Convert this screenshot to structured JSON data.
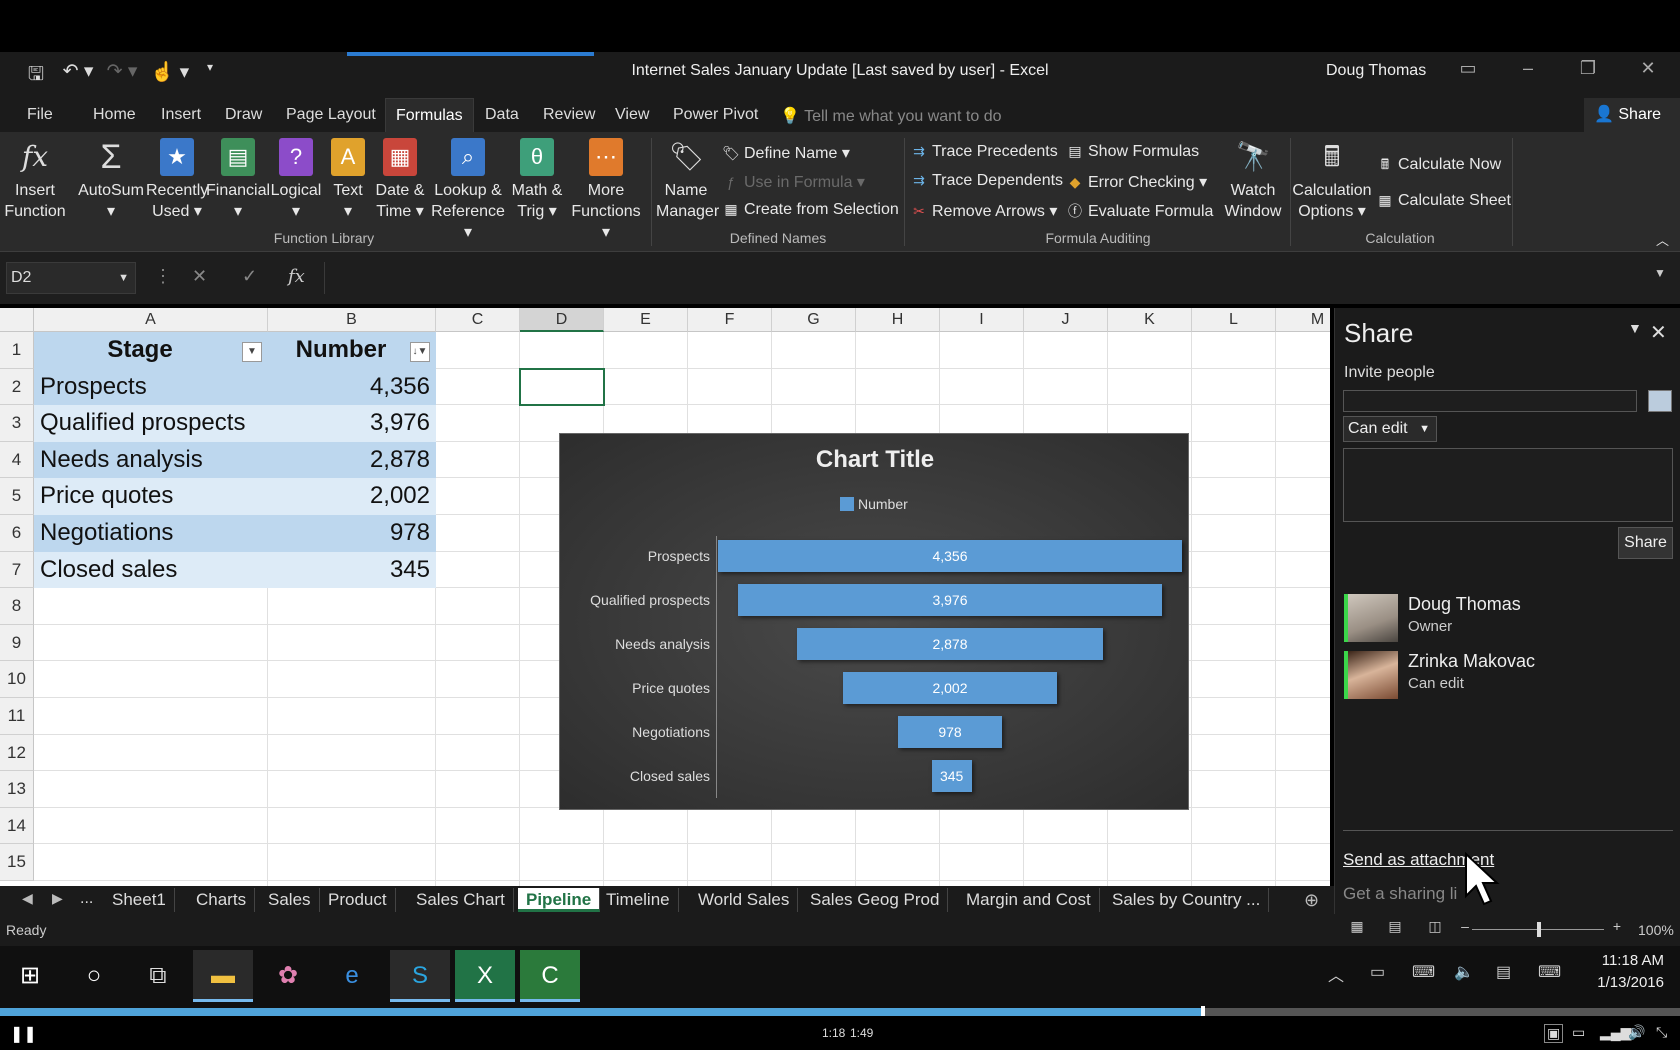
{
  "window": {
    "title": "Internet Sales January Update [Last saved by user] - Excel",
    "user": "Doug Thomas"
  },
  "ribbon_tabs": [
    "File",
    "Home",
    "Insert",
    "Draw",
    "Page Layout",
    "Formulas",
    "Data",
    "Review",
    "View",
    "Power Pivot"
  ],
  "tell_me": "Tell me what you want to do",
  "share_button": "Share",
  "ribbon": {
    "function_library": {
      "group_label": "Function Library",
      "buttons": [
        {
          "l1": "Insert",
          "l2": "Function",
          "icon": "fx"
        },
        {
          "l1": "AutoSum",
          "l2": "▾",
          "icon": "Σ"
        },
        {
          "l1": "Recently",
          "l2": "Used ▾",
          "icon": "★"
        },
        {
          "l1": "Financial",
          "l2": "▾",
          "icon": "▤"
        },
        {
          "l1": "Logical",
          "l2": "▾",
          "icon": "?"
        },
        {
          "l1": "Text",
          "l2": "▾",
          "icon": "A"
        },
        {
          "l1": "Date &",
          "l2": "Time ▾",
          "icon": "▦"
        },
        {
          "l1": "Lookup &",
          "l2": "Reference ▾",
          "icon": "⌕"
        },
        {
          "l1": "Math &",
          "l2": "Trig ▾",
          "icon": "θ"
        },
        {
          "l1": "More",
          "l2": "Functions ▾",
          "icon": "⋯"
        }
      ]
    },
    "defined_names": {
      "group_label": "Defined Names",
      "name_manager_1": "Name",
      "name_manager_2": "Manager",
      "define_name": "Define Name ▾",
      "use_in_formula": "Use in Formula ▾",
      "create_from_selection": "Create from Selection"
    },
    "formula_auditing": {
      "group_label": "Formula Auditing",
      "trace_precedents": "Trace Precedents",
      "trace_dependents": "Trace Dependents",
      "remove_arrows": "Remove Arrows ▾",
      "show_formulas": "Show Formulas",
      "error_checking": "Error Checking ▾",
      "evaluate_formula": "Evaluate Formula",
      "watch_1": "Watch",
      "watch_2": "Window"
    },
    "calculation": {
      "group_label": "Calculation",
      "options_1": "Calculation",
      "options_2": "Options ▾",
      "calc_now": "Calculate Now",
      "calc_sheet": "Calculate Sheet"
    }
  },
  "formula_bar": {
    "name_box": "D2",
    "formula": ""
  },
  "grid": {
    "columns": [
      "A",
      "B",
      "C",
      "D",
      "E",
      "F",
      "G",
      "H",
      "I",
      "J",
      "K",
      "L",
      "M"
    ],
    "rows": [
      "1",
      "2",
      "3",
      "4",
      "5",
      "6",
      "7",
      "8",
      "9",
      "10",
      "11",
      "12",
      "13",
      "14",
      "15"
    ],
    "header": {
      "stage": "Stage",
      "number": "Number"
    },
    "data": [
      {
        "stage": "Prospects",
        "number": "4,356"
      },
      {
        "stage": "Qualified prospects",
        "number": "3,976"
      },
      {
        "stage": "Needs analysis",
        "number": "2,878"
      },
      {
        "stage": "Price quotes",
        "number": "2,002"
      },
      {
        "stage": "Negotiations",
        "number": "978"
      },
      {
        "stage": "Closed sales",
        "number": "345"
      }
    ]
  },
  "chart_data": {
    "type": "bar",
    "orientation": "horizontal-funnel",
    "title": "Chart Title",
    "categories": [
      "Prospects",
      "Qualified prospects",
      "Needs analysis",
      "Price quotes",
      "Negotiations",
      "Closed sales"
    ],
    "series": [
      {
        "name": "Number",
        "values": [
          4356,
          3976,
          2878,
          2002,
          978,
          345
        ],
        "labels": [
          "4,356",
          "3,976",
          "2,878",
          "2,002",
          "978",
          "345"
        ],
        "color": "#5b9bd5"
      }
    ],
    "legend": "top"
  },
  "share_pane": {
    "title": "Share",
    "invite_label": "Invite people",
    "permission": "Can edit",
    "share_button": "Share",
    "people": [
      {
        "name": "Doug Thomas",
        "role": "Owner"
      },
      {
        "name": "Zrinka Makovac",
        "role": "Can edit"
      }
    ],
    "send_attachment": "Send as attachment",
    "sharing_link": "Get a sharing li"
  },
  "sheet_tabs": [
    "Sheet1",
    "Charts",
    "Sales",
    "Product",
    "Sales Chart",
    "Pipeline",
    "Timeline",
    "World Sales",
    "Sales Geog Prod",
    "Margin and Cost",
    "Sales by Country ..."
  ],
  "active_sheet": "Pipeline",
  "status": {
    "ready": "Ready",
    "zoom": "100%"
  },
  "taskbar": {
    "time": "11:18 AM",
    "date": "1/13/2016"
  },
  "player": {
    "current": "1:18",
    "total": "1:49",
    "progress": 0.716
  },
  "colors": {
    "excel_green": "#217346",
    "bar_blue": "#5b9bd5",
    "table_band_dark": "#bdd7ee",
    "table_band_light": "#ddebf7"
  }
}
